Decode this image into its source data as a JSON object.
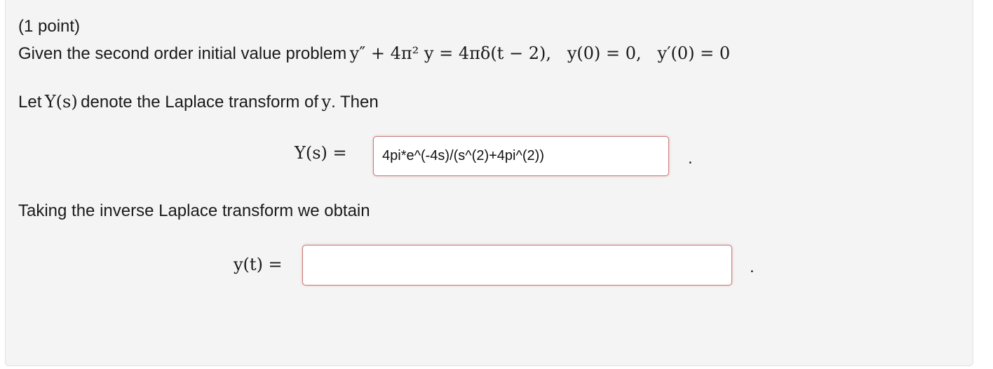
{
  "points": "(1 point)",
  "problem": {
    "intro": "Given the second order initial value problem",
    "equation": "y″ + 4π² y = 4πδ(t − 2),   y(0) = 0,   y′(0) = 0"
  },
  "laplace_sentence": {
    "prefix": "Let",
    "Ys": "Y(s)",
    "middle": "denote the Laplace transform of",
    "y": "y",
    "suffix": ". Then"
  },
  "Ys_label": "Y(s) =",
  "Ys_answer": "4pi*e^(-4s)/(s^(2)+4pi^(2))",
  "inverse_text": "Taking the inverse Laplace transform we obtain",
  "yt_label": "y(t) =",
  "yt_answer": "",
  "period": "."
}
